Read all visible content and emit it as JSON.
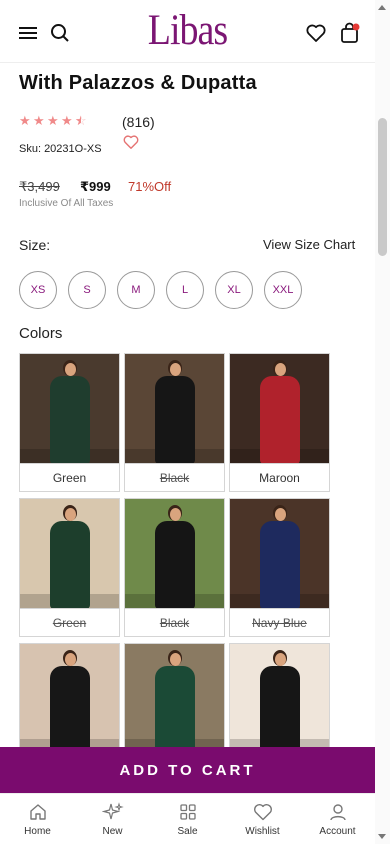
{
  "header": {
    "logo_text": "Libas",
    "menu_icon": "hamburger-menu-icon",
    "search_icon": "search-icon",
    "wishlist_icon": "heart-icon",
    "bag_icon": "shopping-bag-icon"
  },
  "product": {
    "title_partial": "With Palazzos & Dupatta",
    "rating": 4.5,
    "review_count": "(816)",
    "sku": "Sku: 20231O-XS",
    "mrp": "₹3,499",
    "price": "₹999",
    "discount": "71%Off",
    "tax_note": "Inclusive Of All Taxes"
  },
  "size": {
    "label": "Size:",
    "chart_link": "View Size Chart",
    "options": [
      "XS",
      "S",
      "M",
      "L",
      "XL",
      "XXL"
    ]
  },
  "colors": {
    "label": "Colors",
    "swatches": [
      {
        "name": "Green",
        "out_of_stock": false,
        "bg": "#4a3a2e",
        "outfit": "#1f3d2e"
      },
      {
        "name": "Black",
        "out_of_stock": true,
        "bg": "#5a4636",
        "outfit": "#161616"
      },
      {
        "name": "Maroon",
        "out_of_stock": false,
        "bg": "#3c2a22",
        "outfit": "#b0222c"
      },
      {
        "name": "Green",
        "out_of_stock": true,
        "bg": "#d8c7ae",
        "outfit": "#1d3e2c"
      },
      {
        "name": "Black",
        "out_of_stock": true,
        "bg": "#6f8a4a",
        "outfit": "#151515"
      },
      {
        "name": "Navy Blue",
        "out_of_stock": true,
        "bg": "#4b3428",
        "outfit": "#1e2a5e"
      },
      {
        "name": "",
        "out_of_stock": false,
        "bg": "#d7c3b0",
        "outfit": "#171717"
      },
      {
        "name": "",
        "out_of_stock": false,
        "bg": "#8a7a62",
        "outfit": "#1b4a36"
      },
      {
        "name": "",
        "out_of_stock": false,
        "bg": "#efe5da",
        "outfit": "#161616"
      }
    ]
  },
  "cta": {
    "add_to_cart": "ADD TO CART"
  },
  "bottom_nav": [
    {
      "label": "Home",
      "icon": "home-icon"
    },
    {
      "label": "New",
      "icon": "sparkle-icon"
    },
    {
      "label": "Sale",
      "icon": "grid-icon"
    },
    {
      "label": "Wishlist",
      "icon": "heart-icon"
    },
    {
      "label": "Account",
      "icon": "user-icon"
    }
  ],
  "colors_theme": {
    "brand": "#7a0b6e",
    "star": "#f08a8a",
    "discount": "#c0392b"
  }
}
